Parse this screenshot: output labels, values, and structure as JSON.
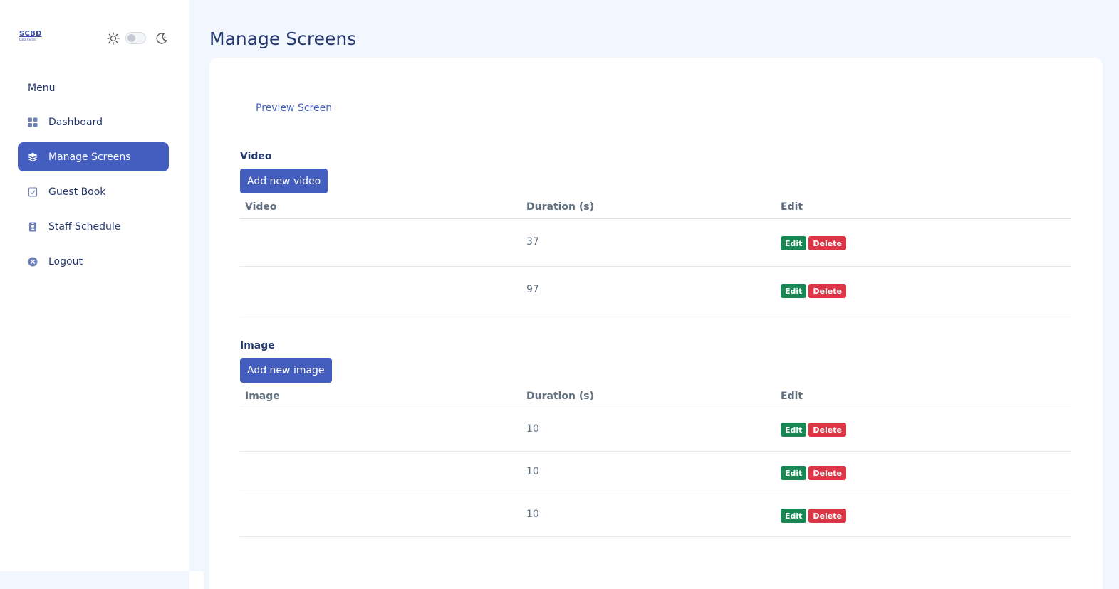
{
  "sidebar": {
    "logo": {
      "line1": "SCBD",
      "line2": "Data Center"
    },
    "menu_title": "Menu",
    "items": [
      {
        "label": "Dashboard",
        "icon": "grid-icon",
        "active": false
      },
      {
        "label": "Manage Screens",
        "icon": "layers-icon",
        "active": true
      },
      {
        "label": "Guest Book",
        "icon": "checklist-icon",
        "active": false
      },
      {
        "label": "Staff Schedule",
        "icon": "person-badge-icon",
        "active": false
      },
      {
        "label": "Logout",
        "icon": "x-circle-icon",
        "active": false
      }
    ]
  },
  "header": {
    "title": "Manage Screens"
  },
  "main": {
    "preview_link": "Preview Screen",
    "video": {
      "section_label": "Video",
      "add_button": "Add new video",
      "columns": [
        "Video",
        "Duration (s)",
        "Edit"
      ],
      "rows": [
        {
          "duration": "37",
          "edit": "Edit",
          "delete": "Delete"
        },
        {
          "duration": "97",
          "edit": "Edit",
          "delete": "Delete"
        }
      ]
    },
    "image": {
      "section_label": "Image",
      "add_button": "Add new image",
      "columns": [
        "Image",
        "Duration (s)",
        "Edit"
      ],
      "rows": [
        {
          "duration": "10",
          "edit": "Edit",
          "delete": "Delete"
        },
        {
          "duration": "10",
          "edit": "Edit",
          "delete": "Delete"
        },
        {
          "duration": "10",
          "edit": "Edit",
          "delete": "Delete"
        }
      ]
    }
  },
  "colors": {
    "accent": "#435ebe",
    "edit": "#198754",
    "delete": "#dc3545",
    "text": "#25396f",
    "background": "#f2f7ff"
  }
}
